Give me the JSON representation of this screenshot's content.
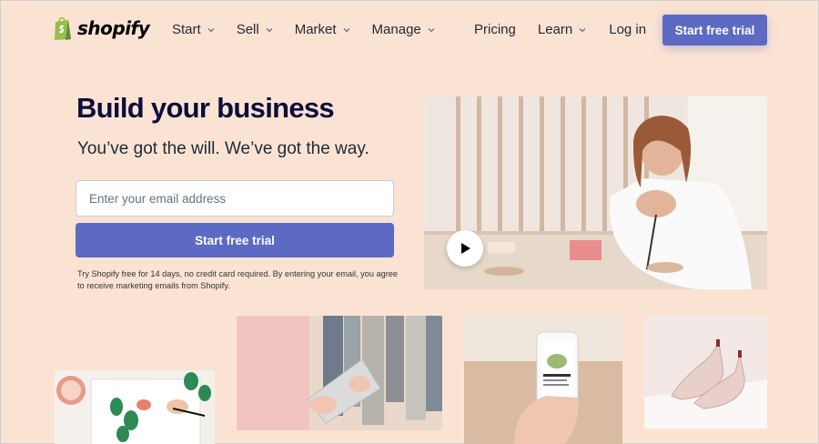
{
  "header": {
    "logo_text": "shopify",
    "nav": [
      {
        "label": "Start"
      },
      {
        "label": "Sell"
      },
      {
        "label": "Market"
      },
      {
        "label": "Manage"
      }
    ],
    "pricing": "Pricing",
    "learn": "Learn",
    "login": "Log in",
    "cta": "Start free trial"
  },
  "hero": {
    "title": "Build your business",
    "subtitle": "You’ve got the will. We’ve got the way.",
    "email_placeholder": "Enter your email address",
    "cta": "Start free trial",
    "disclaimer": "Try Shopify free for 14 days, no credit card required. By entering your email, you agree to receive marketing emails from Shopify."
  },
  "colors": {
    "background": "#fbe3d3",
    "accent": "#5c6ac4",
    "brand_green": "#95bf47"
  },
  "icons": [
    "shopify-bag-icon",
    "chevron-down-icon",
    "play-icon"
  ]
}
